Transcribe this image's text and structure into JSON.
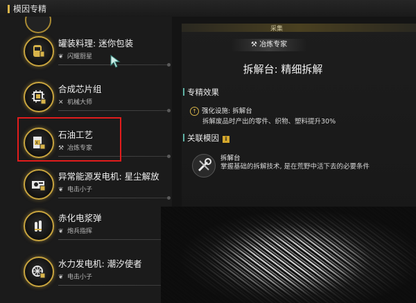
{
  "header": {
    "title": "模因专精"
  },
  "left_list": [
    {
      "name": "罐装料理: 迷你包装",
      "sub": "闪耀厨星",
      "sub_icon": "leaf-icon",
      "icon": "can-icon"
    },
    {
      "name": "合成芯片组",
      "sub": "机械大师",
      "sub_icon": "tools-icon",
      "icon": "chip-icon"
    },
    {
      "name": "石油工艺",
      "sub": "冶炼专家",
      "sub_icon": "hammer-icon",
      "icon": "oil-barrel-icon"
    },
    {
      "name": "异常能源发电机: 星尘解放",
      "sub": "电击小子",
      "sub_icon": "leaf-icon",
      "icon": "generator-icon"
    },
    {
      "name": "赤化电浆弹",
      "sub": "炮兵指挥",
      "sub_icon": "leaf-icon",
      "icon": "bullets-icon"
    },
    {
      "name": "水力发电机: 潮汐使者",
      "sub": "电击小子",
      "sub_icon": "leaf-icon",
      "icon": "hydro-generator-icon"
    }
  ],
  "detail": {
    "tab": "采集",
    "profession": "冶炼专家",
    "title": "拆解台: 精细拆解",
    "effects_heading": "专精效果",
    "effect_name": "强化设施: 拆解台",
    "effect_desc": "拆解废品时产出的零件、织物、塑料提升30%",
    "linked_heading": "关联模因",
    "linked_badge": "i",
    "linked_name": "拆解台",
    "linked_desc": "掌握基础的拆解技术, 是在荒野中活下去的必要条件"
  },
  "colors": {
    "accent_gold": "#c9a53f",
    "highlight_red": "#e21c1c",
    "section_teal": "#5fb3a5"
  }
}
